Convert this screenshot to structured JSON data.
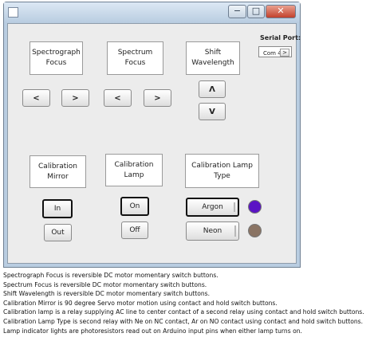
{
  "window": {
    "minimize_glyph": "−",
    "maximize_glyph": "□",
    "close_glyph": "✕"
  },
  "panels": {
    "spectrograph_focus": "Spectrograph\nFocus",
    "spectrum_focus": "Spectrum\nFocus",
    "shift_wavelength": "Shift\nWavelength",
    "calibration_mirror": "Calibration\nMirror",
    "calibration_lamp": "Calibration\nLamp",
    "calibration_lamp_type": "Calibration Lamp\nType"
  },
  "buttons": {
    "spectrograph_left": "<",
    "spectrograph_right": ">",
    "spectrum_left": "<",
    "spectrum_right": ">",
    "wavelength_up": "Λ",
    "wavelength_down": "V",
    "mirror_in": "In",
    "mirror_out": "Out",
    "lamp_on": "On",
    "lamp_off": "Off",
    "lamp_argon": "Argon",
    "lamp_neon": "Neon"
  },
  "serial": {
    "label": "Serial Port:",
    "value": "Com 4",
    "arrow": ">"
  },
  "indicators": {
    "argon_color": "#5a13c4",
    "neon_color": "#8a7464",
    "argon_icon": "argon-lamp-indicator-icon",
    "neon_icon": "neon-lamp-indicator-icon"
  },
  "caption": [
    "Spectrograph Focus is reversible DC motor momentary switch buttons.",
    "Spectrum Focus is reversible DC motor momentary switch buttons.",
    "Shift Wavelength is reversible DC motor momentary switch buttons.",
    "Calibration Mirror is 90 degree Servo motor motion using contact and hold switch buttons.",
    "Calibration lamp is a relay supplying AC line to center contact of a second relay using contact and hold switch buttons.",
    "Calibration Lamp Type is second relay with Ne on NC contact, Ar on NO contact using contact and hold switch buttons.",
    "Lamp indicator lights are photoresistors read out on Arduino input pins when either lamp turns on."
  ]
}
